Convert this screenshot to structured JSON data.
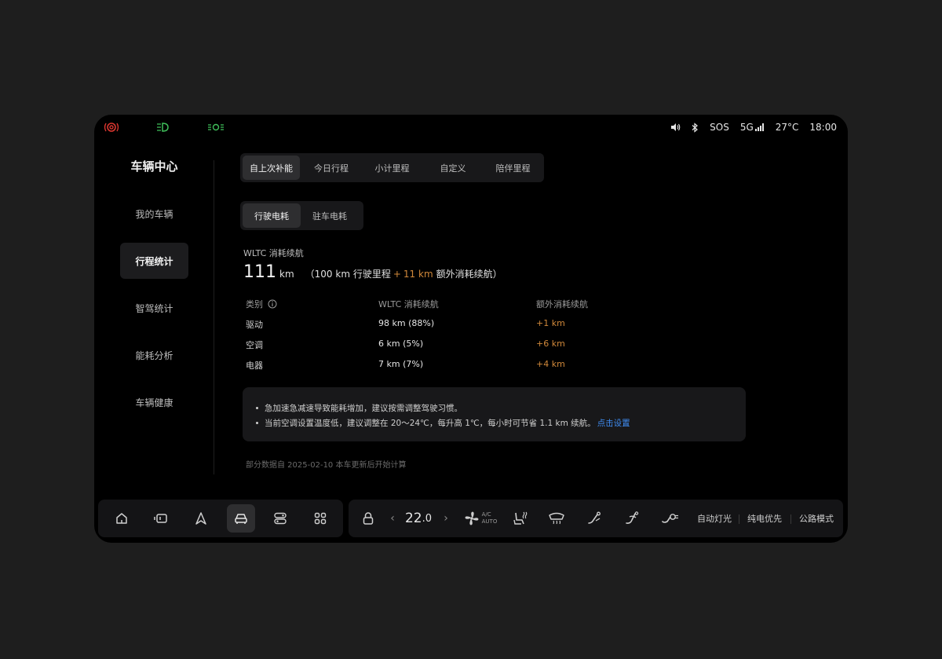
{
  "colors": {
    "accent_orange": "#d0883a",
    "link_blue": "#3f8ef5",
    "brake_red": "#d9362f",
    "light_green": "#3fbf5a"
  },
  "status_bar": {
    "icons_left": [
      "brake-warning-icon",
      "headlight-icon",
      "parking-light-icon"
    ],
    "icons_right": [
      "volume-icon",
      "bluetooth-icon"
    ],
    "sos": "SOS",
    "network": "5G",
    "temperature": "27°C",
    "time": "18:00"
  },
  "sidebar": {
    "title": "车辆中心",
    "items": [
      {
        "label": "我的车辆"
      },
      {
        "label": "行程统计"
      },
      {
        "label": "智驾统计"
      },
      {
        "label": "能耗分析"
      },
      {
        "label": "车辆健康"
      }
    ],
    "active_index": 1
  },
  "tabs": {
    "items": [
      {
        "label": "自上次补能"
      },
      {
        "label": "今日行程"
      },
      {
        "label": "小计里程"
      },
      {
        "label": "自定义"
      },
      {
        "label": "陪伴里程"
      }
    ],
    "active_index": 0
  },
  "subtabs": {
    "items": [
      {
        "label": "行驶电耗"
      },
      {
        "label": "驻车电耗"
      }
    ],
    "active_index": 0
  },
  "summary": {
    "label": "WLTC 消耗续航",
    "value": "111",
    "unit": "km",
    "paren_open": "（",
    "driven": "100 km 行驶里程",
    "plus": "+",
    "extra": "11 km",
    "extra_label": "额外消耗续航",
    "paren_close": "）"
  },
  "table": {
    "headers": [
      "类别",
      "WLTC 消耗续航",
      "额外消耗续航"
    ],
    "rows": [
      {
        "category": "驱动",
        "wltc": "98 km (88%)",
        "extra": "+1 km"
      },
      {
        "category": "空调",
        "wltc": "6 km (5%)",
        "extra": "+6 km"
      },
      {
        "category": "电器",
        "wltc": "7 km (7%)",
        "extra": "+4 km"
      }
    ]
  },
  "tips": {
    "items": [
      {
        "text": "急加速急减速导致能耗增加，建议按需调整驾驶习惯。",
        "link": ""
      },
      {
        "text": "当前空调设置温度低，建议调整在 20～24℃，每升高 1℃，每小时可节省 1.1 km 续航。",
        "link": "点击设置"
      }
    ]
  },
  "footnote": "部分数据自 2025-02-10 本车更新后开始计算",
  "dock": {
    "left_icons": [
      "home-icon",
      "vehicle-icon",
      "navigation-icon",
      "car-front-icon",
      "toggle-switch-icon",
      "apps-grid-icon"
    ],
    "active_index": 3,
    "climate": {
      "prev": "‹",
      "temp_int": "22",
      "temp_dec": ".0",
      "next": "›",
      "ac_label": "A/C",
      "auto_label": "AUTO"
    },
    "right_icons": [
      "lock-icon",
      "fan-icon",
      "seat-heat-icon",
      "rear-defrost-icon",
      "seat-adjust-icon",
      "seat-massage-icon",
      "steering-heat-icon"
    ],
    "modes": [
      "自动灯光",
      "纯电优先",
      "公路模式"
    ]
  }
}
